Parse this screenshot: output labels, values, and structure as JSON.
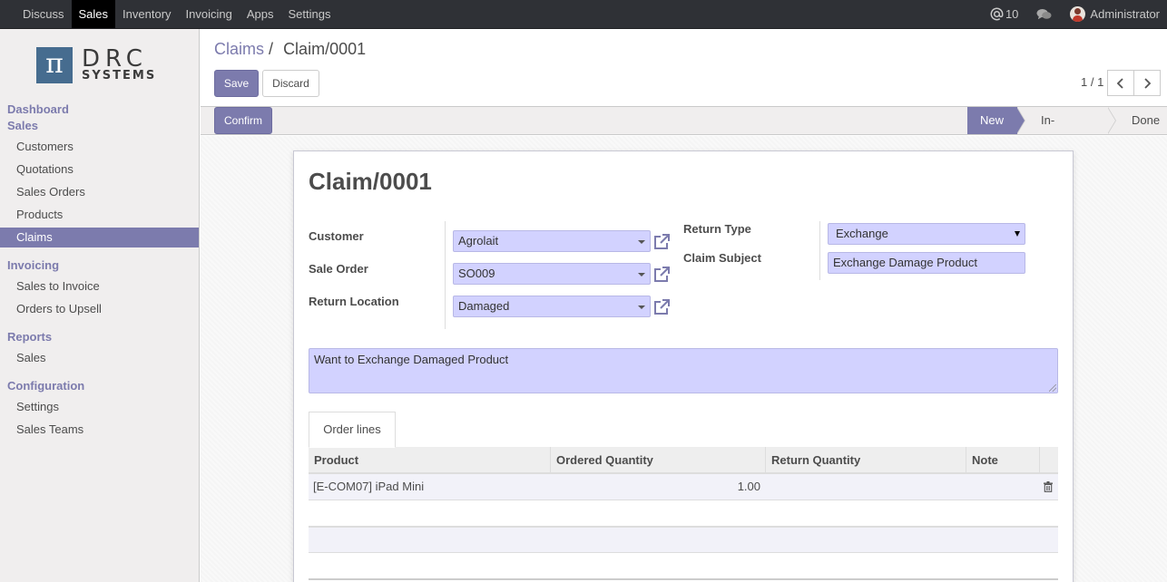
{
  "topbar": {
    "menu": [
      "Discuss",
      "Sales",
      "Inventory",
      "Invoicing",
      "Apps",
      "Settings"
    ],
    "active_menu": "Sales",
    "messages_count": "10",
    "user": "Administrator"
  },
  "logo": {
    "symbol": "π",
    "line1": "DRC",
    "line2": "SYSTEMS"
  },
  "sidebar": {
    "dashboard": "Dashboard",
    "sales_header": "Sales",
    "sales_items": [
      "Customers",
      "Quotations",
      "Sales Orders",
      "Products",
      "Claims"
    ],
    "active_item": "Claims",
    "invoicing_header": "Invoicing",
    "invoicing_items": [
      "Sales to Invoice",
      "Orders to Upsell"
    ],
    "reports_header": "Reports",
    "reports_items": [
      "Sales"
    ],
    "configuration_header": "Configuration",
    "configuration_items": [
      "Settings",
      "Sales Teams"
    ]
  },
  "breadcrumb": {
    "parent": "Claims",
    "separator": "/",
    "current": "Claim/0001"
  },
  "buttons": {
    "save": "Save",
    "discard": "Discard",
    "confirm": "Confirm"
  },
  "pager": {
    "value": "1 / 1",
    "prev_icon": "chevron-left-icon",
    "next_icon": "chevron-right-icon"
  },
  "statusbar": {
    "stages": [
      "New",
      "In-Progress",
      "Done"
    ],
    "current": "New"
  },
  "form": {
    "title": "Claim/0001",
    "customer_label": "Customer",
    "customer_value": "Agrolait",
    "sale_order_label": "Sale Order",
    "sale_order_value": "SO009",
    "return_location_label": "Return Location",
    "return_location_value": "Damaged",
    "return_type_label": "Return Type",
    "return_type_value": "Exchange",
    "claim_subject_label": "Claim Subject",
    "claim_subject_value": "Exchange Damage Product",
    "description": "Want to Exchange Damaged Product"
  },
  "notebook": {
    "tab": "Order lines",
    "columns": [
      "Product",
      "Ordered Quantity",
      "Return Quantity",
      "Note"
    ],
    "rows": [
      {
        "product": "[E-COM07] iPad Mini",
        "ordered_quantity": "1.00",
        "return_quantity": "",
        "note": ""
      }
    ]
  },
  "colors": {
    "accent": "#7c7bad",
    "topbar": "#2f3136",
    "field_bg": "#d2d2ff",
    "logo_blue": "#466c8f"
  }
}
